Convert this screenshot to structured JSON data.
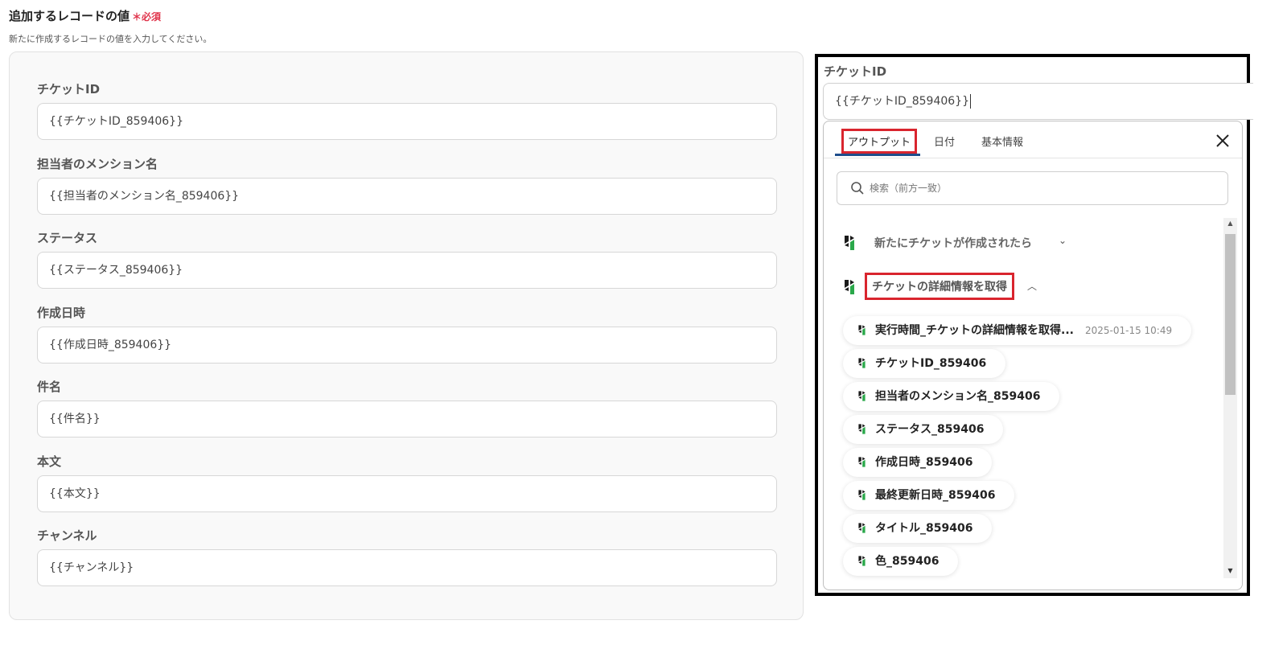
{
  "header": {
    "title": "追加するレコードの値",
    "required": "＊必須",
    "description": "新たに作成するレコードの値を入力してください。"
  },
  "form": {
    "fields": [
      {
        "label": "チケットID",
        "value": "{{チケットID_859406}}"
      },
      {
        "label": "担当者のメンション名",
        "value": "{{担当者のメンション名_859406}}"
      },
      {
        "label": "ステータス",
        "value": "{{ステータス_859406}}"
      },
      {
        "label": "作成日時",
        "value": "{{作成日時_859406}}"
      },
      {
        "label": "件名",
        "value": "{{件名}}"
      },
      {
        "label": "本文",
        "value": "{{本文}}"
      },
      {
        "label": "チャンネル",
        "value": "{{チャンネル}}"
      }
    ]
  },
  "editor": {
    "label": "チケットID",
    "value": "{{チケットID_859406}}"
  },
  "dropdown": {
    "tabs": [
      "アウトプット",
      "日付",
      "基本情報"
    ],
    "search_placeholder": "検索（前方一致）",
    "groups": [
      {
        "label": "新たにチケットが作成されたら",
        "state": "collapsed"
      },
      {
        "label": "チケットの詳細情報を取得",
        "state": "expanded"
      }
    ],
    "items": [
      {
        "label": "実行時間_チケットの詳細情報を取得...",
        "meta": "2025-01-15 10:49"
      },
      {
        "label": "チケットID_859406"
      },
      {
        "label": "担当者のメンション名_859406"
      },
      {
        "label": "ステータス_859406"
      },
      {
        "label": "作成日時_859406"
      },
      {
        "label": "最終更新日時_859406"
      },
      {
        "label": "タイトル_859406"
      },
      {
        "label": "色_859406"
      }
    ]
  },
  "colors": {
    "accent_red": "#d9252e",
    "tab_underline": "#1f4e8c",
    "logo_dark": "#1a1a1a",
    "logo_green": "#2aa84a"
  },
  "icons": {
    "close": "close-icon",
    "search": "search-icon",
    "app_logo": "app-logo-icon",
    "chevron_down": "chevron-down-icon",
    "chevron_up": "chevron-up-icon"
  }
}
